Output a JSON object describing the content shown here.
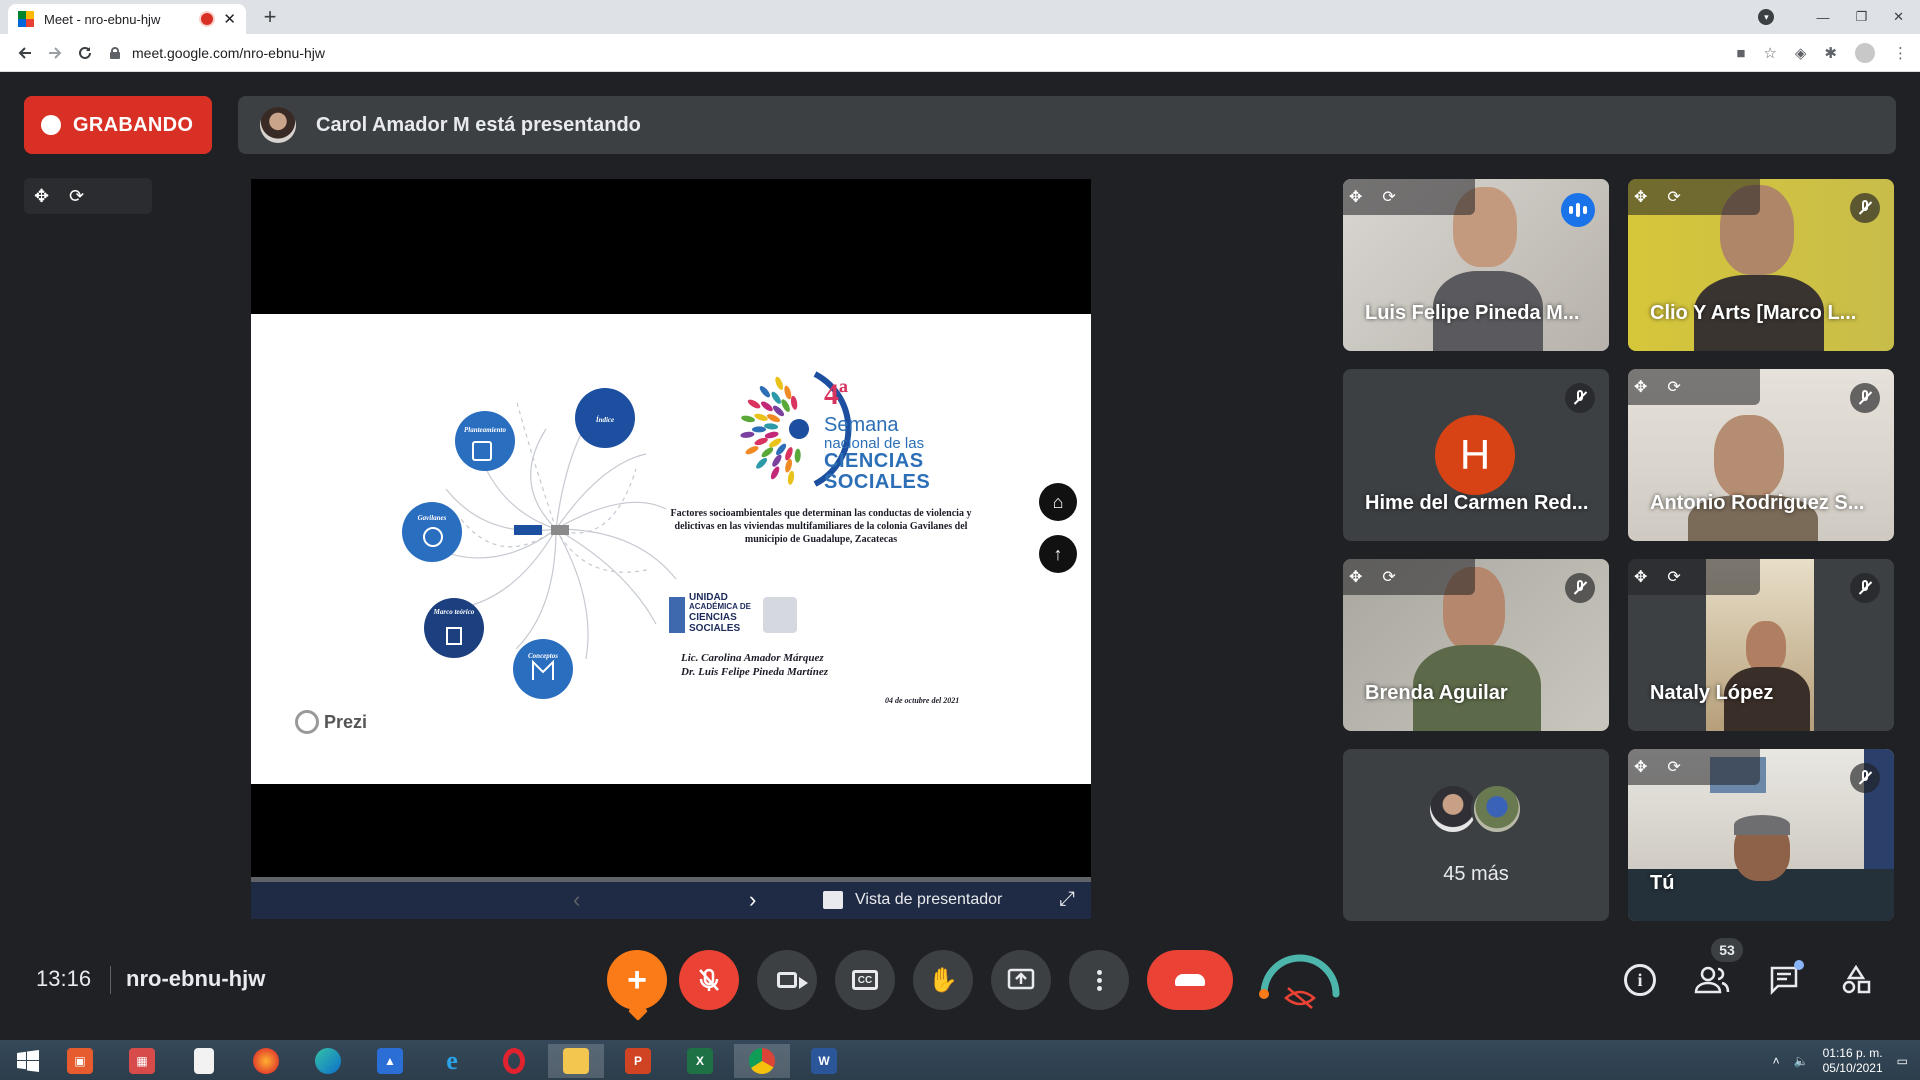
{
  "browser": {
    "tab_title": "Meet - nro-ebnu-hjw",
    "tab_close": "✕",
    "new_tab": "+",
    "url": "meet.google.com/nro-ebnu-hjw",
    "window_controls": [
      "—",
      "❐",
      "✕"
    ]
  },
  "recording": {
    "label": "GRABANDO",
    "color": "#d93025"
  },
  "presenting": {
    "text": "Carol Amador M está presentando"
  },
  "slide": {
    "edition": "4ª",
    "event_line1": "Semana",
    "event_line2": "nacional de las",
    "event_line3": "CIENCIAS",
    "event_line4": "SOCIALES",
    "description": "Factores socioambientales que determinan las conductas de violencia y delictivas en las viviendas multifamiliares de la colonia Gavilanes del municipio de Guadalupe, Zacatecas",
    "unit_line1": "UNIDAD",
    "unit_line2": "ACADÉMICA DE",
    "unit_line3": "CIENCIAS",
    "unit_line4": "SOCIALES",
    "author1": "Lic. Carolina Amador Márquez",
    "author2": "Dr. Luis Felipe Pineda Martínez",
    "date": "04 de octubre del 2021",
    "nodes": [
      "Índice",
      "Planteamiento",
      "Gavilanes",
      "Marco teórico",
      "Conceptos"
    ],
    "brand": "Prezi"
  },
  "presentation_controls": {
    "presenter_view": "Vista de presentador"
  },
  "participants": [
    {
      "name": "Luis Felipe Pineda M...",
      "speaking": true
    },
    {
      "name": "Clio Y Arts [Marco L...",
      "muted": true
    },
    {
      "name": "Hime del Carmen Red...",
      "initial": "H",
      "muted": true,
      "avatar_color": "#d84315"
    },
    {
      "name": "Antonio Rodriguez S...",
      "muted": true
    },
    {
      "name": "Brenda Aguilar",
      "muted": true
    },
    {
      "name": "Nataly López",
      "muted": true
    },
    {
      "name": "Tú",
      "muted": true
    }
  ],
  "more_participants": {
    "label": "45 más"
  },
  "meeting": {
    "time": "13:16",
    "code": "nro-ebnu-hjw"
  },
  "bottom_controls": {
    "people_count": "53"
  },
  "taskbar": {
    "time": "01:16 p. m.",
    "date": "05/10/2021"
  },
  "colors": {
    "accent_blue": "#8ab4f8",
    "end_call_red": "#ea4335",
    "add_orange": "#fa7b17",
    "meet_bg": "#202124"
  }
}
